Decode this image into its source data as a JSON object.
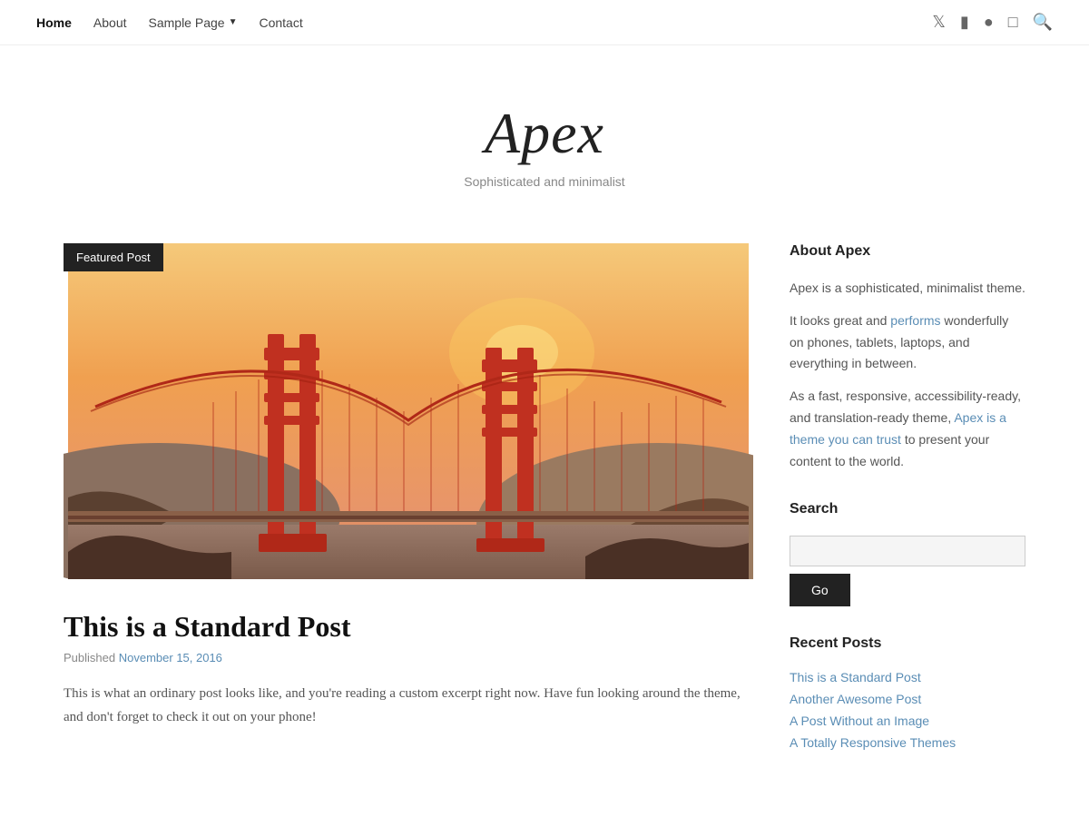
{
  "nav": {
    "items": [
      {
        "label": "Home",
        "active": true
      },
      {
        "label": "About",
        "active": false
      },
      {
        "label": "Sample Page",
        "active": false,
        "hasDropdown": true
      },
      {
        "label": "Contact",
        "active": false
      }
    ],
    "icons": [
      "twitter",
      "facebook",
      "pinterest",
      "instagram",
      "search"
    ]
  },
  "site": {
    "title": "Apex",
    "subtitle": "Sophisticated and minimalist"
  },
  "featured": {
    "label": "Featured Post",
    "image_alt": "Golden Gate Bridge at sunset"
  },
  "post": {
    "title": "This is a Standard Post",
    "meta_prefix": "Published",
    "date": "November 15, 2016",
    "excerpt": "This is what an ordinary post looks like, and you're reading a custom excerpt right now. Have fun looking around the theme, and don't forget to check it out on your phone!"
  },
  "sidebar": {
    "about_heading": "About Apex",
    "about_para1": "Apex is a sophisticated, minimalist theme.",
    "about_para2": "It looks great and performs wonderfully on phones, tablets, laptops, and everything in between.",
    "about_para2_link": "performs",
    "about_para3": "As a fast, responsive, accessibility-ready, and translation-ready theme, Apex is a theme you can trust to present your content to the world.",
    "search_heading": "Search",
    "search_placeholder": "",
    "search_button": "Go",
    "recent_heading": "Recent Posts",
    "recent_posts": [
      "This is a Standard Post",
      "Another Awesome Post",
      "A Post Without an Image",
      "A Totally Responsive Themes"
    ]
  }
}
